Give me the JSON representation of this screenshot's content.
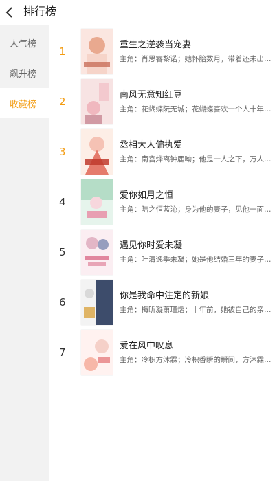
{
  "header": {
    "title": "排行榜"
  },
  "sidebar": {
    "items": [
      {
        "label": "人气榜"
      },
      {
        "label": "飙升榜"
      },
      {
        "label": "收藏榜"
      }
    ],
    "active_index": 2
  },
  "books": [
    {
      "rank": "1",
      "title": "重生之逆袭当宠妻",
      "desc": "主角：肖思睿黎诺；她怀胎数月，带着还未出生的孩子…",
      "cover_colors": [
        "#fbe6e0",
        "#e9a98f",
        "#c96f5b"
      ]
    },
    {
      "rank": "2",
      "title": "南风无意知红豆",
      "desc": "主角：花蝴蝶阮无城；花蝴蝶喜欢一个人十年，…",
      "cover_colors": [
        "#f7e3e3",
        "#f0b8bf",
        "#b8697a"
      ]
    },
    {
      "rank": "3",
      "title": "丞相大人偏执爱",
      "desc": "主角：南宫烨离钟鹿呦；他是一人之下，万人之上…",
      "cover_colors": [
        "#fdeee6",
        "#e57b6c",
        "#c0392b"
      ]
    },
    {
      "rank": "4",
      "title": "爱你如月之恒",
      "desc": "主角：陆之恒蓝沁；身为他的妻子，见他一面却…",
      "cover_colors": [
        "#e6f4ec",
        "#9fd3b8",
        "#e98aa4"
      ]
    },
    {
      "rank": "5",
      "title": "遇见你时爱未凝",
      "desc": "主角：叶清逸季未凝；她是他结婚三年的妻子。…",
      "cover_colors": [
        "#fbeef2",
        "#e3b6c6",
        "#6c7aa8"
      ]
    },
    {
      "rank": "6",
      "title": "你是我命中注定的新娘",
      "desc": "主角：梅昕凝萧瑾熠；十年前，她被自己的亲生…",
      "cover_colors": [
        "#f3f3f3",
        "#3d4c6b",
        "#d9a441"
      ]
    },
    {
      "rank": "7",
      "title": "爱在风中叹息",
      "desc": "主角：冷枳方沐霖；冷枳香瞬的瞬间，方沐霖对…",
      "cover_colors": [
        "#fff2f0",
        "#f7b7a8",
        "#e36f71"
      ]
    }
  ],
  "icons": {
    "back": "chevron-left-icon"
  },
  "colors": {
    "accent": "#f39c12",
    "sidebar_bg": "#f2f2f2"
  }
}
